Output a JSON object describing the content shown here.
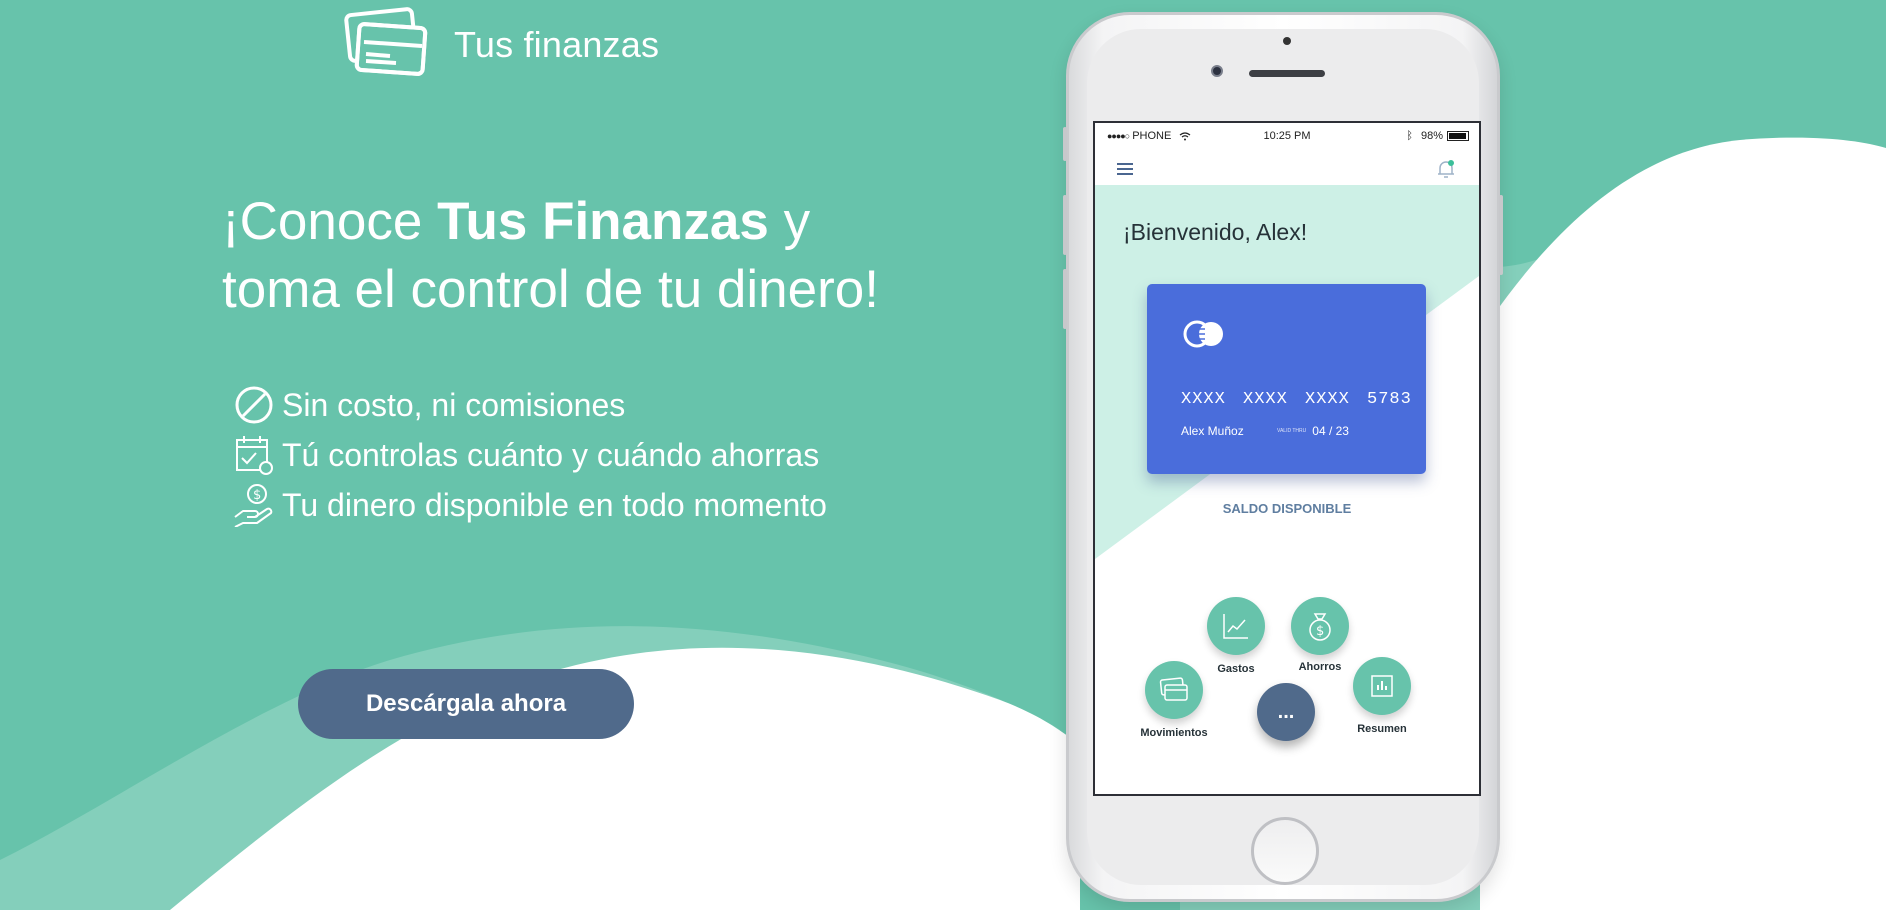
{
  "brand": {
    "name": "Tus finanzas"
  },
  "hero": {
    "line1_prefix": "¡Conoce ",
    "line1_bold": "Tus Finanzas",
    "line1_suffix": " y",
    "line2": "toma el control de tu dinero!"
  },
  "features": [
    {
      "icon": "no-fees-icon",
      "text": "Sin costo, ni comisiones"
    },
    {
      "icon": "calendar-savings-icon",
      "text": "Tú controlas cuánto y cuándo ahorras"
    },
    {
      "icon": "hand-money-icon",
      "text": "Tu dinero disponible en todo momento"
    }
  ],
  "cta": {
    "label": "Descárgala ahora"
  },
  "phone": {
    "status": {
      "carrier": "PHONE",
      "time": "10:25 PM",
      "battery": "98%"
    },
    "greeting": "¡Bienvenido, Alex!",
    "card": {
      "number": "XXXX XXXX XXXX 5783",
      "holder": "Alex Muñoz",
      "valid_label": "VALID THRU",
      "expiry": "04 / 23"
    },
    "balance_label": "SALDO DISPONIBLE",
    "actions": {
      "gastos": "Gastos",
      "ahorros": "Ahorros",
      "movimientos": "Movimientos",
      "resumen": "Resumen",
      "more": "..."
    }
  },
  "colors": {
    "background": "#67c3ab",
    "wave_light": "#84cfbb",
    "wave_white": "#ffffff",
    "button": "#506a8b",
    "card": "#4a6ddb",
    "screen_band": "#cdf0e6"
  }
}
